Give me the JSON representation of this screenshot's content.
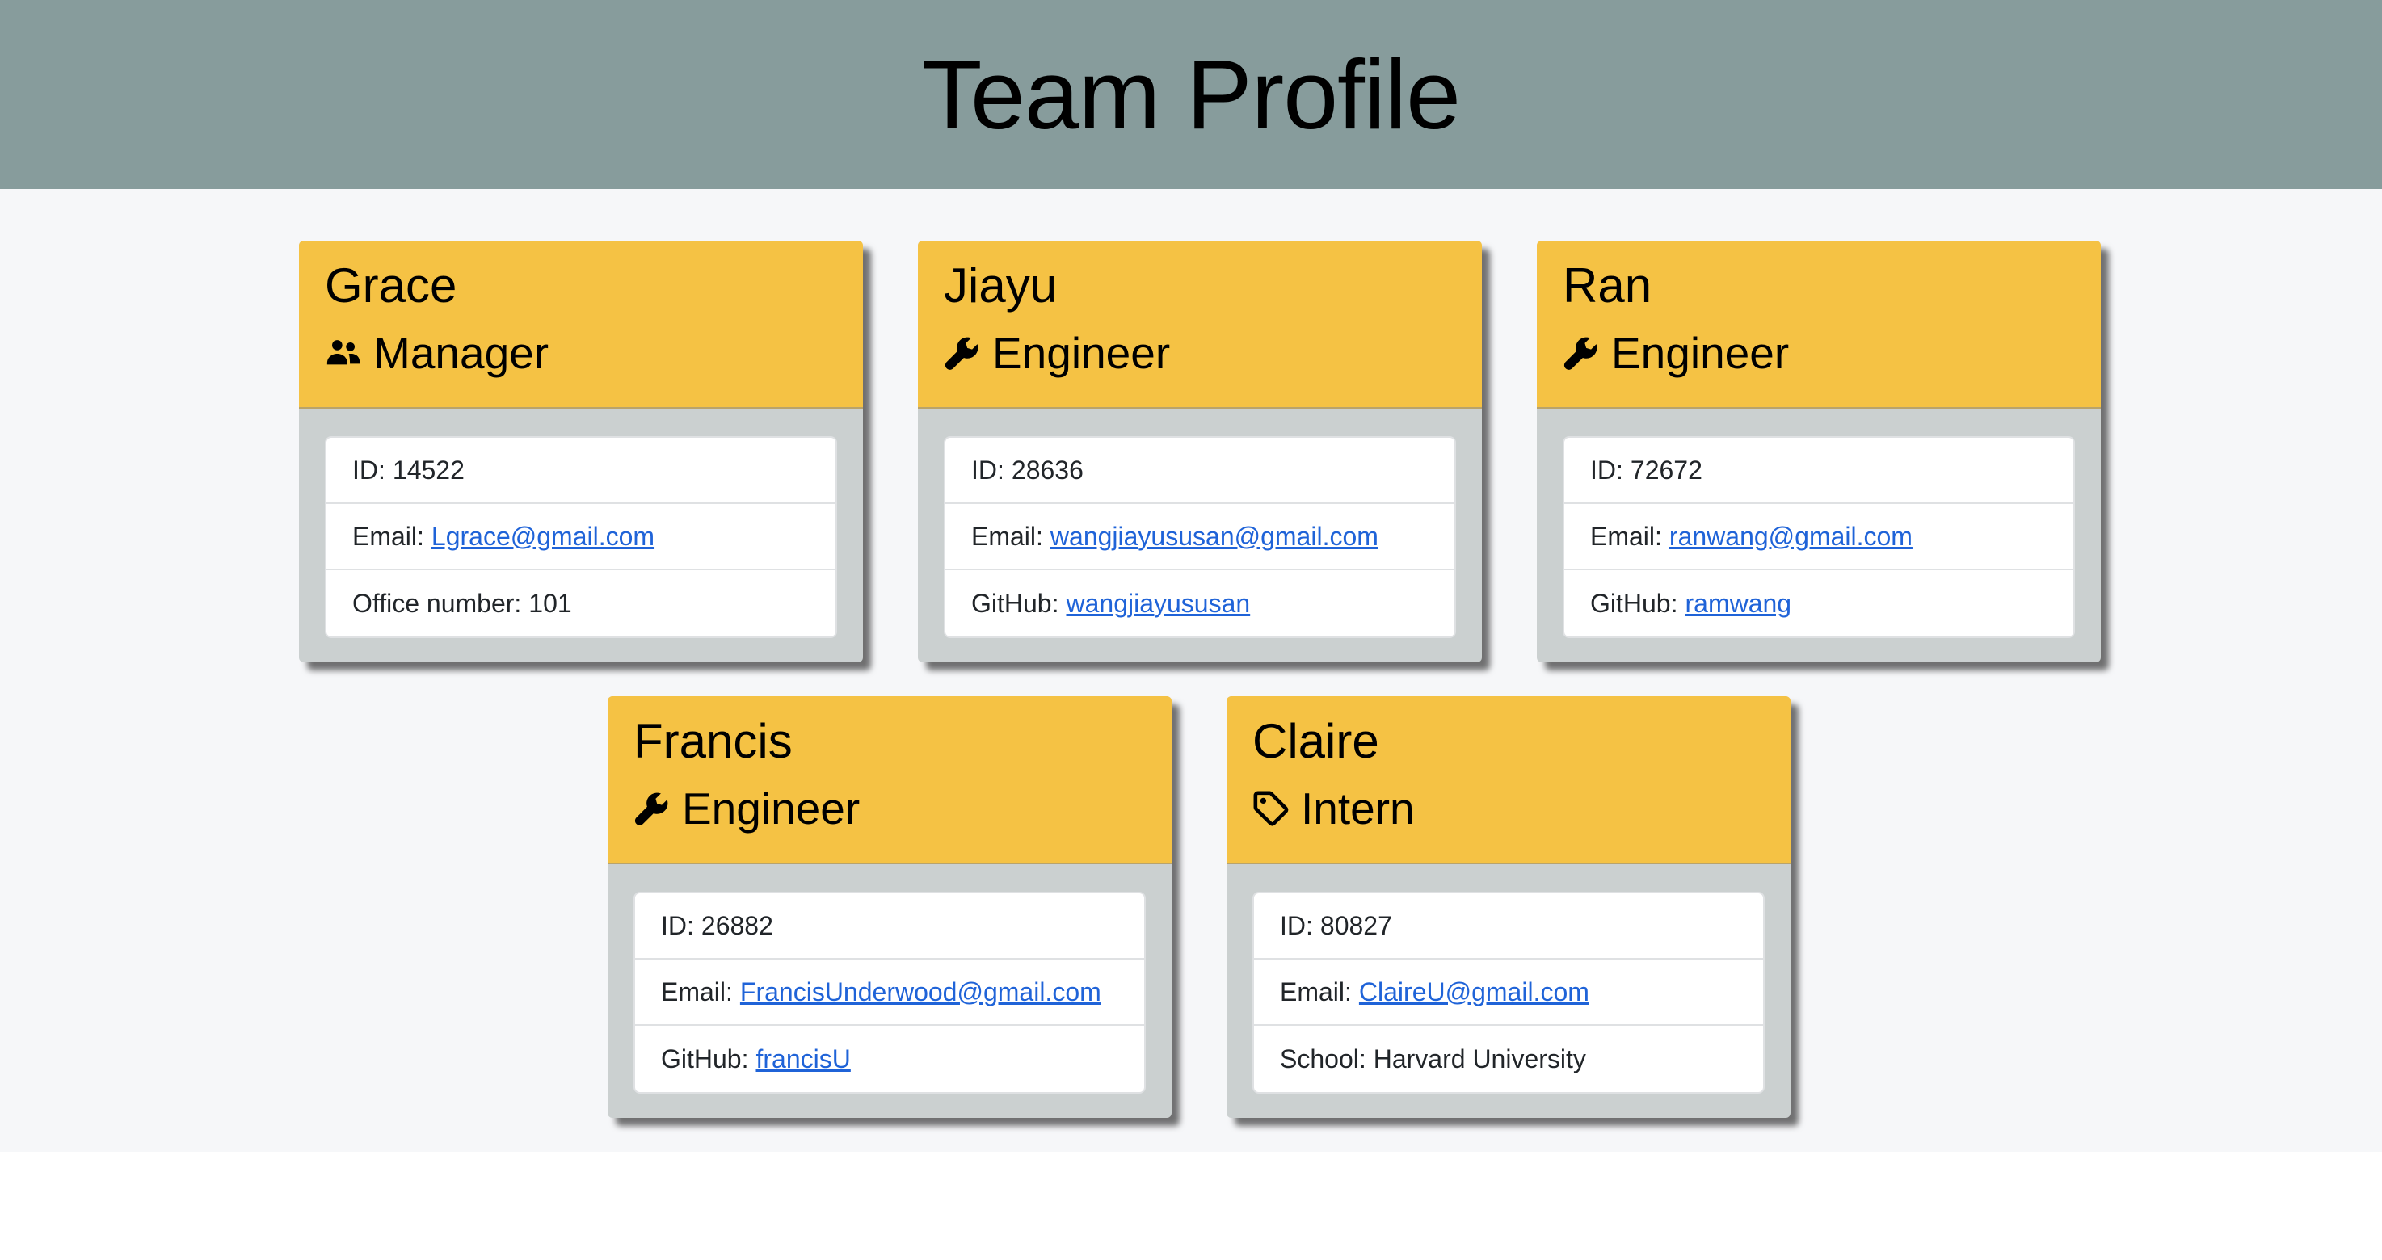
{
  "page": {
    "title": "Team Profile"
  },
  "colors": {
    "header_bg": "#879c9c",
    "page_bg": "#f6f7f9",
    "card_header_bg": "#f5c244",
    "card_body_bg": "#cbd0d0",
    "link": "#1f63d8"
  },
  "team": [
    {
      "name": "Grace",
      "role": "Manager",
      "role_icon": "users-icon",
      "id_label": "ID:",
      "id": "14522",
      "email_label": "Email:",
      "email": "Lgrace@gmail.com",
      "extra_label": "Office number:",
      "extra_value": "101"
    },
    {
      "name": "Jiayu",
      "role": "Engineer",
      "role_icon": "wrench-icon",
      "id_label": "ID:",
      "id": "28636",
      "email_label": "Email:",
      "email": "wangjiayususan@gmail.com",
      "extra_label": "GitHub:",
      "extra_value": "wangjiayususan"
    },
    {
      "name": "Ran",
      "role": "Engineer",
      "role_icon": "wrench-icon",
      "id_label": "ID:",
      "id": "72672",
      "email_label": "Email:",
      "email": "ranwang@gmail.com",
      "extra_label": "GitHub:",
      "extra_value": "ramwang"
    },
    {
      "name": "Francis",
      "role": "Engineer",
      "role_icon": "wrench-icon",
      "id_label": "ID:",
      "id": "26882",
      "email_label": "Email:",
      "email": "FrancisUnderwood@gmail.com",
      "extra_label": "GitHub:",
      "extra_value": "francisU"
    },
    {
      "name": "Claire",
      "role": "Intern",
      "role_icon": "tag-icon",
      "id_label": "ID:",
      "id": "80827",
      "email_label": "Email:",
      "email": "ClaireU@gmail.com",
      "extra_label": "School:",
      "extra_value": "Harvard University"
    }
  ]
}
